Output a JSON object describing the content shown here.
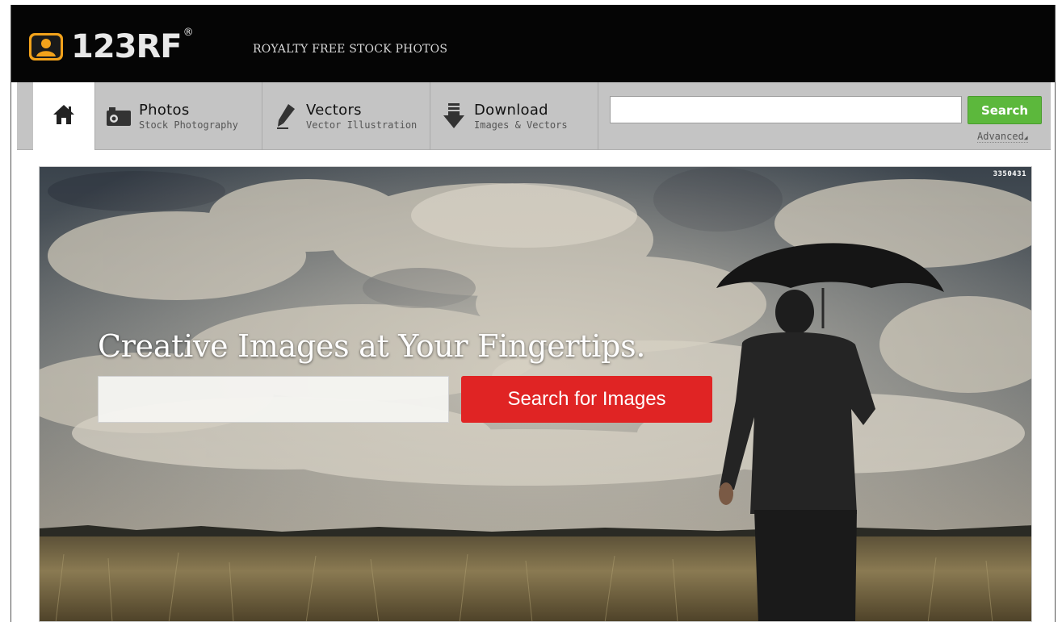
{
  "header": {
    "logo_text": "123RF",
    "logo_reg": "®",
    "tagline": "ROYALTY FREE STOCK PHOTOS"
  },
  "nav": {
    "home_icon": "home-icon",
    "tabs": [
      {
        "label": "Photos",
        "sub": "Stock Photography",
        "icon": "camera-icon"
      },
      {
        "label": "Vectors",
        "sub": "Vector Illustration",
        "icon": "pen-nib-icon"
      },
      {
        "label": "Download",
        "sub": "Images & Vectors",
        "icon": "download-icon"
      }
    ],
    "search": {
      "placeholder": "",
      "value": "",
      "button_label": "Search"
    },
    "advanced_label": "Advanced"
  },
  "hero": {
    "image_id": "3350431",
    "title": "Creative Images at Your Fingertips.",
    "search_placeholder": "",
    "search_button_label": "Search for Images"
  },
  "colors": {
    "topbar_bg": "#050505",
    "nav_bg": "#c4c4c4",
    "search_green": "#5cb83c",
    "hero_red": "#e02424",
    "logo_orange": "#f2a21b"
  }
}
